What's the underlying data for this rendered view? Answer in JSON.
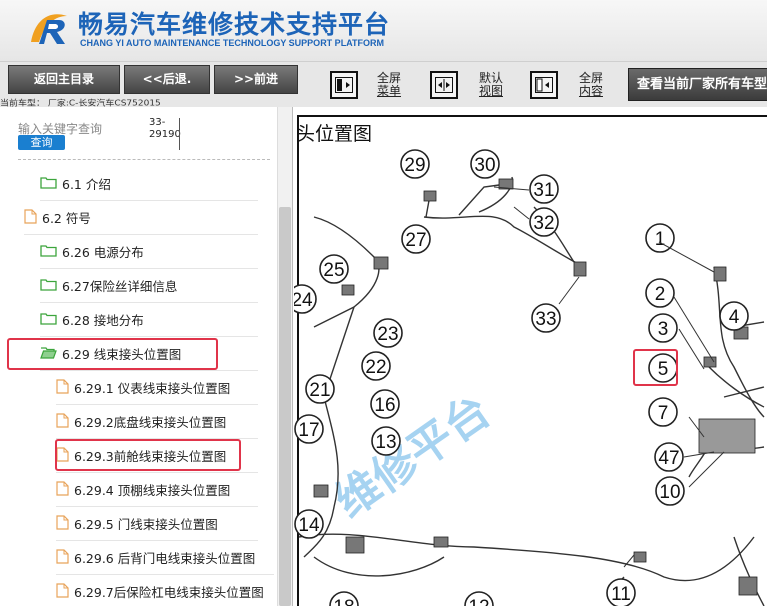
{
  "header": {
    "title": "畅易汽车维修技术支持平台",
    "subtitle": "CHANG YI AUTO MAINTENANCE TECHNOLOGY SUPPORT PLATFORM"
  },
  "toolbar": {
    "back_home": "返回主目录",
    "back": "<<后退.",
    "forward": ">>前进",
    "fullscreen_menu_1": "全屏",
    "fullscreen_menu_2": "菜单",
    "default_view_1": "默认",
    "default_view_2": "视图",
    "fullscreen_content_1": "全屏",
    "fullscreen_content_2": "内容",
    "all_models": "查看当前厂家所有车型"
  },
  "vehicle_info": "当前车型：  厂家:C-长安汽车CS752015",
  "sidebar": {
    "search_placeholder": "输入关键字查询",
    "search_button": "查询",
    "page_num_1": "33-",
    "page_num_2": "29190",
    "items": [
      {
        "label": "6.1 介绍",
        "icon": "folder-icon"
      },
      {
        "label": "6.2 符号",
        "icon": "page-icon"
      },
      {
        "label": "6.26 电源分布",
        "icon": "folder-icon"
      },
      {
        "label": "6.27保险丝详细信息",
        "icon": "folder-icon"
      },
      {
        "label": "6.28 接地分布",
        "icon": "folder-icon"
      },
      {
        "label": "6.29 线束接头位置图",
        "icon": "folder-open-icon"
      },
      {
        "label": "6.29.1 仪表线束接头位置图",
        "icon": "page-icon"
      },
      {
        "label": "6.29.2底盘线束接头位置图",
        "icon": "page-icon"
      },
      {
        "label": "6.29.3前舱线束接头位置图",
        "icon": "page-icon"
      },
      {
        "label": "6.29.4 顶棚线束接头位置图",
        "icon": "page-icon"
      },
      {
        "label": "6.29.5 门线束接头位置图",
        "icon": "page-icon"
      },
      {
        "label": "6.29.6 后背门电线束接头位置图",
        "icon": "page-icon"
      },
      {
        "label": "6.29.7后保险杠电线束接头位置图",
        "icon": "page-icon"
      }
    ]
  },
  "main": {
    "page_title": "头位置图",
    "watermark": "维修平台",
    "callouts": [
      "29",
      "30",
      "31",
      "32",
      "27",
      "25",
      "24",
      "23",
      "22",
      "21",
      "16",
      "17",
      "13",
      "14",
      "18",
      "12",
      "11",
      "33",
      "1",
      "2",
      "3",
      "4",
      "5",
      "7",
      "47",
      "10"
    ]
  },
  "colors": {
    "brand_blue": "#1d64b8",
    "highlight_red": "#e0344a",
    "folder_green": "#3ca53c",
    "page_orange": "#e8a35a"
  }
}
